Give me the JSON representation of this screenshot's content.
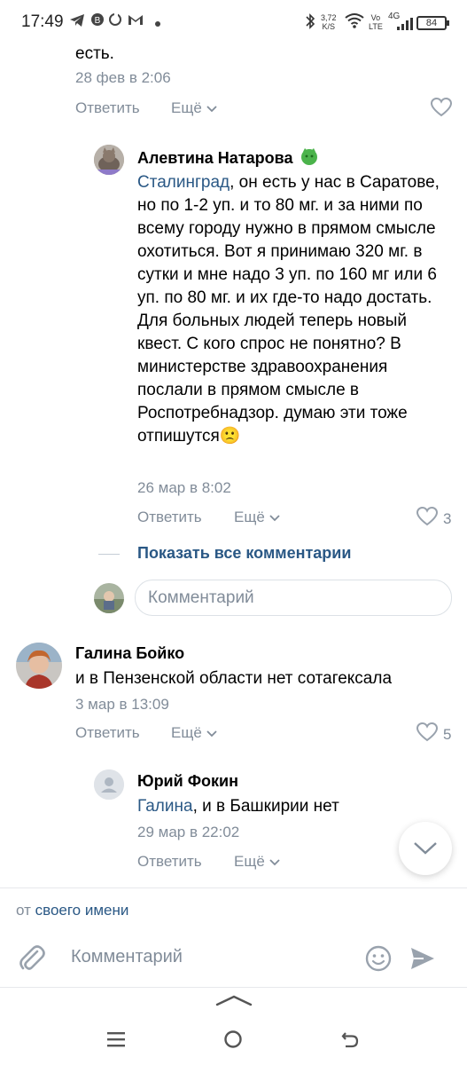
{
  "status_bar": {
    "time": "17:49",
    "net_speed_value": "3,72",
    "net_speed_unit": "K/S",
    "volte_1": "Vo",
    "volte_2": "LTE",
    "signal": "4G",
    "battery": "84"
  },
  "top_comment": {
    "text_tail": "есть.",
    "date": "28 фев в 2:06",
    "reply_label": "Ответить",
    "more_label": "Ещё"
  },
  "reply_1": {
    "author": "Алевтина Натарова",
    "mention": "Сталинград",
    "text": ", он есть у нас в Саратове, но по 1-2 уп. и то 80 мг. и за ними по всему городу нужно в прямом смысле охотиться. Вот я принимаю 320 мг. в сутки и мне надо 3 уп. по 160 мг или 6 уп. по 80 мг. и их где-то надо достать. Для больных людей теперь новый квест. С кого спрос не понятно? В министерстве здравоохранения послали в прямом смысле в Роспотребнадзор. думаю эти тоже отпишутся",
    "emoji": "🙁",
    "date": "26 мар в 8:02",
    "reply_label": "Ответить",
    "more_label": "Ещё",
    "likes": "3"
  },
  "show_all": {
    "label": "Показать все комментарии"
  },
  "thread_input": {
    "placeholder": "Комментарий"
  },
  "comment_2": {
    "author": "Галина Бойко",
    "text": "и в Пензенской области нет сотагексала",
    "date": "3 мар в 13:09",
    "reply_label": "Ответить",
    "more_label": "Ещё",
    "likes": "5"
  },
  "reply_2": {
    "author": "Юрий Фокин",
    "mention": "Галина",
    "text": ", и в Башкирии нет",
    "date": "29 мар в 22:02",
    "reply_label": "Ответить",
    "more_label": "Ещё"
  },
  "composer": {
    "from_prefix": "от",
    "from_link": "своего имени",
    "placeholder": "Комментарий"
  },
  "colors": {
    "link": "#2a5885",
    "meta": "#818c99",
    "accent": "#3f8ae0"
  }
}
